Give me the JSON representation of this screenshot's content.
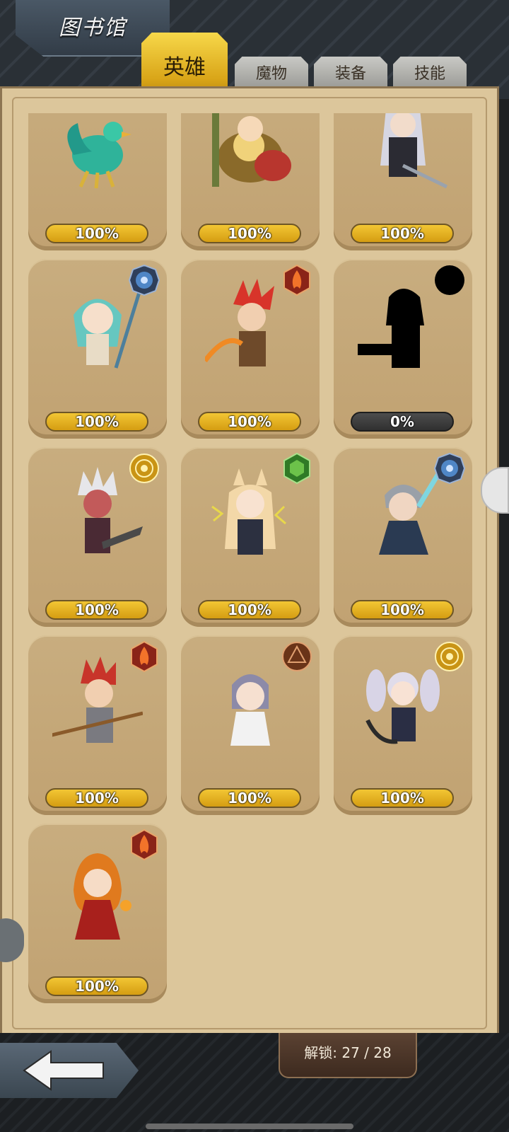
{
  "header": {
    "title": "图书馆"
  },
  "tabs": [
    {
      "label": "英雄",
      "active": true
    },
    {
      "label": "魔物",
      "active": false
    },
    {
      "label": "装备",
      "active": false
    },
    {
      "label": "技能",
      "active": false
    }
  ],
  "cards": [
    {
      "name": "teal-bird-hero",
      "progress": "100%",
      "element": "none",
      "unlocked": true
    },
    {
      "name": "golden-armored-hero",
      "progress": "100%",
      "element": "none",
      "unlocked": true
    },
    {
      "name": "silver-haired-knight",
      "progress": "100%",
      "element": "none",
      "unlocked": true
    },
    {
      "name": "teal-elf-girl",
      "progress": "100%",
      "element": "water",
      "unlocked": true
    },
    {
      "name": "red-haired-swordsman",
      "progress": "100%",
      "element": "fire",
      "unlocked": true
    },
    {
      "name": "locked-gunner",
      "progress": "0%",
      "element": "dark",
      "unlocked": false
    },
    {
      "name": "white-haired-demon",
      "progress": "100%",
      "element": "light",
      "unlocked": true
    },
    {
      "name": "fox-eared-girl",
      "progress": "100%",
      "element": "wind",
      "unlocked": true
    },
    {
      "name": "grey-haired-warrior",
      "progress": "100%",
      "element": "water",
      "unlocked": true
    },
    {
      "name": "red-haired-lancer",
      "progress": "100%",
      "element": "fire",
      "unlocked": true
    },
    {
      "name": "purple-haired-scholar",
      "progress": "100%",
      "element": "earth",
      "unlocked": true
    },
    {
      "name": "twin-tail-scythe-girl",
      "progress": "100%",
      "element": "light",
      "unlocked": true
    },
    {
      "name": "fire-sorceress",
      "progress": "100%",
      "element": "fire",
      "unlocked": true
    }
  ],
  "element_colors": {
    "water": "#4f86c6",
    "fire": "#c8402a",
    "dark": "#000000",
    "light": "#e3b321",
    "wind": "#46a33a",
    "earth": "#8b4a25"
  },
  "footer": {
    "unlock_label": "解锁: 27 / 28",
    "back_icon": "back-arrow-icon"
  }
}
